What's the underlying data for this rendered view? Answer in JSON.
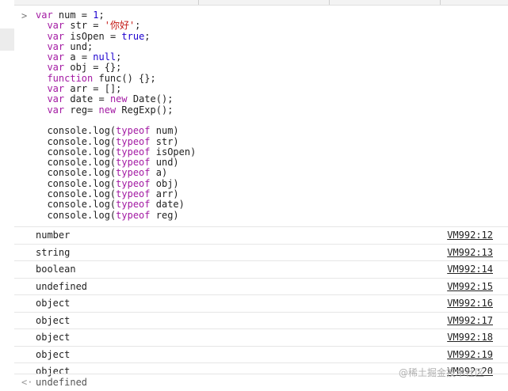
{
  "prompt_symbol": ">",
  "code_lines": [
    [
      {
        "t": "var",
        "c": "kw"
      },
      {
        "t": " num = ",
        "c": "plain"
      },
      {
        "t": "1",
        "c": "num"
      },
      {
        "t": ";",
        "c": "plain"
      }
    ],
    [
      {
        "t": "  ",
        "c": "plain"
      },
      {
        "t": "var",
        "c": "kw"
      },
      {
        "t": " str = ",
        "c": "plain"
      },
      {
        "t": "'你好'",
        "c": "str"
      },
      {
        "t": ";",
        "c": "plain"
      }
    ],
    [
      {
        "t": "  ",
        "c": "plain"
      },
      {
        "t": "var",
        "c": "kw"
      },
      {
        "t": " isOpen = ",
        "c": "plain"
      },
      {
        "t": "true",
        "c": "num"
      },
      {
        "t": ";",
        "c": "plain"
      }
    ],
    [
      {
        "t": "  ",
        "c": "plain"
      },
      {
        "t": "var",
        "c": "kw"
      },
      {
        "t": " und;",
        "c": "plain"
      }
    ],
    [
      {
        "t": "  ",
        "c": "plain"
      },
      {
        "t": "var",
        "c": "kw"
      },
      {
        "t": " a = ",
        "c": "plain"
      },
      {
        "t": "null",
        "c": "num"
      },
      {
        "t": ";",
        "c": "plain"
      }
    ],
    [
      {
        "t": "  ",
        "c": "plain"
      },
      {
        "t": "var",
        "c": "kw"
      },
      {
        "t": " obj = {};",
        "c": "plain"
      }
    ],
    [
      {
        "t": "  ",
        "c": "plain"
      },
      {
        "t": "function",
        "c": "kw"
      },
      {
        "t": " func() {};",
        "c": "plain"
      }
    ],
    [
      {
        "t": "  ",
        "c": "plain"
      },
      {
        "t": "var",
        "c": "kw"
      },
      {
        "t": " arr = [];",
        "c": "plain"
      }
    ],
    [
      {
        "t": "  ",
        "c": "plain"
      },
      {
        "t": "var",
        "c": "kw"
      },
      {
        "t": " date = ",
        "c": "plain"
      },
      {
        "t": "new",
        "c": "kw"
      },
      {
        "t": " Date();",
        "c": "plain"
      }
    ],
    [
      {
        "t": "  ",
        "c": "plain"
      },
      {
        "t": "var",
        "c": "kw"
      },
      {
        "t": " reg= ",
        "c": "plain"
      },
      {
        "t": "new",
        "c": "kw"
      },
      {
        "t": " RegExp();",
        "c": "plain"
      }
    ],
    [],
    [
      {
        "t": "  console.log(",
        "c": "plain"
      },
      {
        "t": "typeof",
        "c": "kw"
      },
      {
        "t": " num)",
        "c": "plain"
      }
    ],
    [
      {
        "t": "  console.log(",
        "c": "plain"
      },
      {
        "t": "typeof",
        "c": "kw"
      },
      {
        "t": " str)",
        "c": "plain"
      }
    ],
    [
      {
        "t": "  console.log(",
        "c": "plain"
      },
      {
        "t": "typeof",
        "c": "kw"
      },
      {
        "t": " isOpen)",
        "c": "plain"
      }
    ],
    [
      {
        "t": "  console.log(",
        "c": "plain"
      },
      {
        "t": "typeof",
        "c": "kw"
      },
      {
        "t": " und)",
        "c": "plain"
      }
    ],
    [
      {
        "t": "  console.log(",
        "c": "plain"
      },
      {
        "t": "typeof",
        "c": "kw"
      },
      {
        "t": " a)",
        "c": "plain"
      }
    ],
    [
      {
        "t": "  console.log(",
        "c": "plain"
      },
      {
        "t": "typeof",
        "c": "kw"
      },
      {
        "t": " obj)",
        "c": "plain"
      }
    ],
    [
      {
        "t": "  console.log(",
        "c": "plain"
      },
      {
        "t": "typeof",
        "c": "kw"
      },
      {
        "t": " arr)",
        "c": "plain"
      }
    ],
    [
      {
        "t": "  console.log(",
        "c": "plain"
      },
      {
        "t": "typeof",
        "c": "kw"
      },
      {
        "t": " date)",
        "c": "plain"
      }
    ],
    [
      {
        "t": "  console.log(",
        "c": "plain"
      },
      {
        "t": "typeof",
        "c": "kw"
      },
      {
        "t": " reg)",
        "c": "plain"
      }
    ]
  ],
  "outputs": [
    {
      "value": "number",
      "source": "VM992:12"
    },
    {
      "value": "string",
      "source": "VM992:13"
    },
    {
      "value": "boolean",
      "source": "VM992:14"
    },
    {
      "value": "undefined",
      "source": "VM992:15"
    },
    {
      "value": "object",
      "source": "VM992:16"
    },
    {
      "value": "object",
      "source": "VM992:17"
    },
    {
      "value": "object",
      "source": "VM992:18"
    },
    {
      "value": "object",
      "source": "VM992:19"
    },
    {
      "value": "object",
      "source": "VM992:20"
    }
  ],
  "result": {
    "arrow": "<·",
    "value": "undefined"
  },
  "watermark": "@稀土掘金技术社区",
  "colors": {
    "keyword": "#a31aa3",
    "string": "#c41a16",
    "literal": "#1c00cf"
  }
}
